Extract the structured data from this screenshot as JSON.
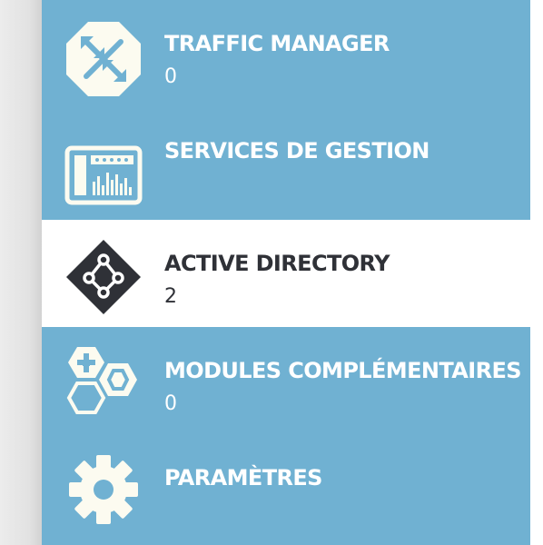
{
  "nav": {
    "items": [
      {
        "label": "TRAFFIC MANAGER",
        "count": "0",
        "icon": "traffic-manager-icon",
        "active": false
      },
      {
        "label": "SERVICES DE GESTION",
        "count": "",
        "icon": "management-services-icon",
        "active": false
      },
      {
        "label": "ACTIVE DIRECTORY",
        "count": "2",
        "icon": "active-directory-icon",
        "active": true
      },
      {
        "label": "MODULES COMPLÉMENTAIRES",
        "count": "0",
        "icon": "add-ons-icon",
        "active": false
      },
      {
        "label": "PARAMÈTRES",
        "count": "",
        "icon": "gear-icon",
        "active": false
      }
    ]
  },
  "colors": {
    "nav_background": "#70b1d2",
    "active_background": "#ffffff",
    "active_text": "#2f3137",
    "icon_light": "#fcfbf0"
  }
}
